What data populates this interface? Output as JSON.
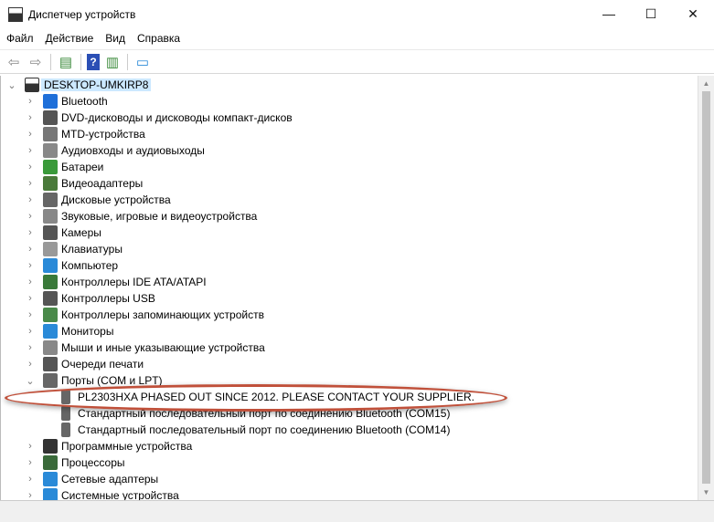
{
  "window": {
    "title": "Диспетчер устройств",
    "minimize": "—",
    "maximize": "☐",
    "close": "✕"
  },
  "menu": [
    "Файл",
    "Действие",
    "Вид",
    "Справка"
  ],
  "toolbar": [
    "back-icon",
    "forward-icon",
    "properties-icon",
    "help-icon",
    "update-driver-icon",
    "scan-hardware-icon"
  ],
  "tree": {
    "root": "DESKTOP-UMKIRP8",
    "categories": [
      {
        "label": "Bluetooth",
        "icon": "bluetooth-icon",
        "color": "#1e6fd9"
      },
      {
        "label": "DVD-дисководы и дисководы компакт-дисков",
        "icon": "dvd-icon",
        "color": "#555"
      },
      {
        "label": "MTD-устройства",
        "icon": "mtd-icon",
        "color": "#777"
      },
      {
        "label": "Аудиовходы и аудиовыходы",
        "icon": "audio-icon",
        "color": "#888"
      },
      {
        "label": "Батареи",
        "icon": "battery-icon",
        "color": "#3a9a3a"
      },
      {
        "label": "Видеоадаптеры",
        "icon": "display-adapter-icon",
        "color": "#4a7a3a"
      },
      {
        "label": "Дисковые устройства",
        "icon": "disk-icon",
        "color": "#666"
      },
      {
        "label": "Звуковые, игровые и видеоустройства",
        "icon": "sound-icon",
        "color": "#888"
      },
      {
        "label": "Камеры",
        "icon": "camera-icon",
        "color": "#555"
      },
      {
        "label": "Клавиатуры",
        "icon": "keyboard-icon",
        "color": "#999"
      },
      {
        "label": "Компьютер",
        "icon": "computer-icon",
        "color": "#2a8ad8"
      },
      {
        "label": "Контроллеры IDE ATA/ATAPI",
        "icon": "ide-icon",
        "color": "#3a7a3a"
      },
      {
        "label": "Контроллеры USB",
        "icon": "usb-icon",
        "color": "#555"
      },
      {
        "label": "Контроллеры запоминающих устройств",
        "icon": "storage-icon",
        "color": "#4a8a4a"
      },
      {
        "label": "Мониторы",
        "icon": "monitor-icon",
        "color": "#2a8ad8"
      },
      {
        "label": "Мыши и иные указывающие устройства",
        "icon": "mouse-icon",
        "color": "#888"
      },
      {
        "label": "Очереди печати",
        "icon": "printer-icon",
        "color": "#555"
      },
      {
        "label": "Порты (COM и LPT)",
        "icon": "port-icon",
        "color": "#666",
        "expanded": true,
        "children": [
          "PL2303HXA PHASED OUT SINCE 2012. PLEASE CONTACT YOUR SUPPLIER.",
          "Стандартный последовательный порт по соединению Bluetooth (COM15)",
          "Стандартный последовательный порт по соединению Bluetooth (COM14)"
        ]
      },
      {
        "label": "Программные устройства",
        "icon": "software-device-icon",
        "color": "#333"
      },
      {
        "label": "Процессоры",
        "icon": "processor-icon",
        "color": "#3a6a3a"
      },
      {
        "label": "Сетевые адаптеры",
        "icon": "network-icon",
        "color": "#2a8ad8"
      },
      {
        "label": "Системные устройства",
        "icon": "system-icon",
        "color": "#2a8ad8"
      }
    ]
  },
  "highlight_color": "#c0503a"
}
